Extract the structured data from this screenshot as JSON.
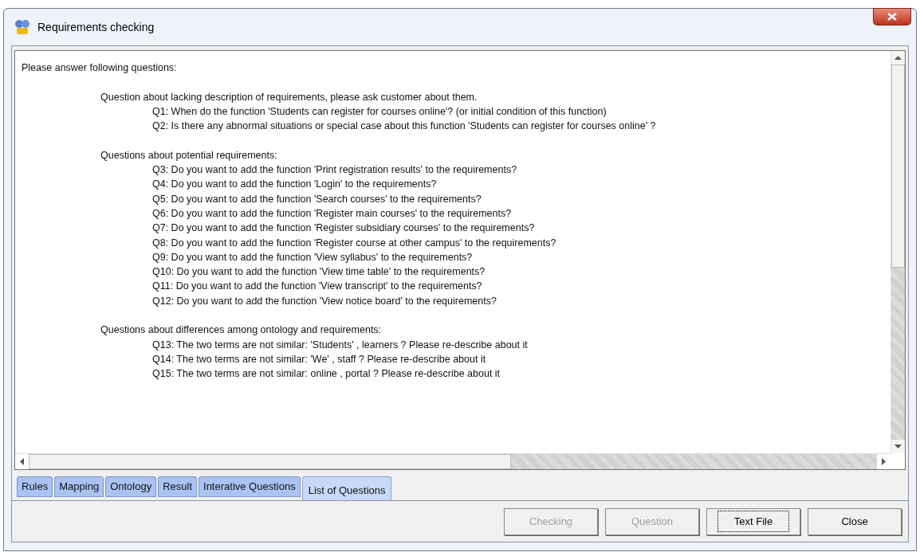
{
  "window": {
    "title": "Requirements checking"
  },
  "content": {
    "intro": "Please answer following questions:",
    "sections": [
      {
        "heading": "Question about lacking description of requirements, please ask customer about them.",
        "questions": [
          "Q1: When do the function 'Students can register for courses online'? (or initial condition of this function)",
          "Q2: Is there any abnormal situations or special case about this function 'Students can register for courses online' ?"
        ]
      },
      {
        "heading": "Questions about potential requirements:",
        "questions": [
          "Q3: Do you want to add the function 'Print registration results' to the requirements?",
          "Q4: Do you want to add the function 'Login' to the requirements?",
          "Q5: Do you want to add the function 'Search courses' to the requirements?",
          "Q6: Do you want to add the function 'Register main courses' to the requirements?",
          "Q7: Do you want to add the function 'Register subsidiary courses' to the requirements?",
          "Q8: Do you want to add the function 'Register course at other campus' to the requirements?",
          "Q9: Do you want to add the function 'View syllabus' to the requirements?",
          "Q10: Do you want to add the function 'View time table' to the requirements?",
          "Q11: Do you want to add the function 'View transcript' to the requirements?",
          "Q12: Do you want to add the function 'View notice board' to the requirements?"
        ]
      },
      {
        "heading": "Questions about differences among ontology and requirements:",
        "questions": [
          "Q13: The two terms are not similar: 'Students' , learners ? Please re-describe about it",
          "Q14: The two terms are not similar: 'We' , staff ? Please re-describe about it",
          "Q15: The two terms are not similar: online , portal ? Please re-describe about it"
        ]
      }
    ]
  },
  "tabs": [
    {
      "label": "Rules",
      "selected": false
    },
    {
      "label": "Mapping",
      "selected": false
    },
    {
      "label": "Ontology",
      "selected": false
    },
    {
      "label": "Result",
      "selected": false
    },
    {
      "label": "Interative Questions",
      "selected": false
    },
    {
      "label": "List of Questions",
      "selected": true
    }
  ],
  "buttons": [
    {
      "label": "Checking",
      "disabled": true,
      "focused": false
    },
    {
      "label": "Question",
      "disabled": true,
      "focused": false
    },
    {
      "label": "Text File",
      "disabled": false,
      "focused": true
    },
    {
      "label": "Close",
      "disabled": false,
      "focused": false
    }
  ]
}
